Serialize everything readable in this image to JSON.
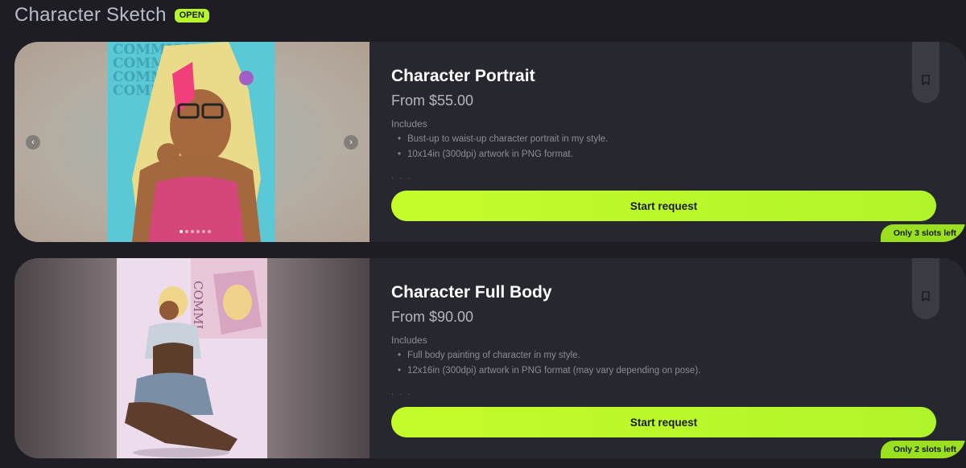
{
  "header": {
    "title": "Character Sketch",
    "status_badge": "OPEN"
  },
  "colors": {
    "background": "#1d1d23",
    "card": "#27272f",
    "accent": "#b6f52a",
    "muted_text": "#8a8d97"
  },
  "cards": [
    {
      "title": "Character Portrait",
      "price": "From $55.00",
      "includes_label": "Includes",
      "features": [
        "Bust-up to waist-up character portrait in my style.",
        "10x14in (300dpi) artwork in PNG format."
      ],
      "ellipsis": "· · ·",
      "cta_label": "Start request",
      "slots_label": "Only 3 slots left",
      "artwork_text": "COMMISSION",
      "carousel": {
        "prev_icon": "‹",
        "next_icon": "›",
        "image_count": 6,
        "active_index": 0
      },
      "bookmark_icon": "bookmark-icon"
    },
    {
      "title": "Character Full Body",
      "price": "From $90.00",
      "includes_label": "Includes",
      "features": [
        "Full body painting of character in my style.",
        "12x16in (300dpi) artwork in PNG format (may vary depending on pose)."
      ],
      "ellipsis": "· · ·",
      "cta_label": "Start request",
      "slots_label": "Only 2 slots left",
      "artwork_text": "COMMI",
      "bookmark_icon": "bookmark-icon"
    }
  ]
}
